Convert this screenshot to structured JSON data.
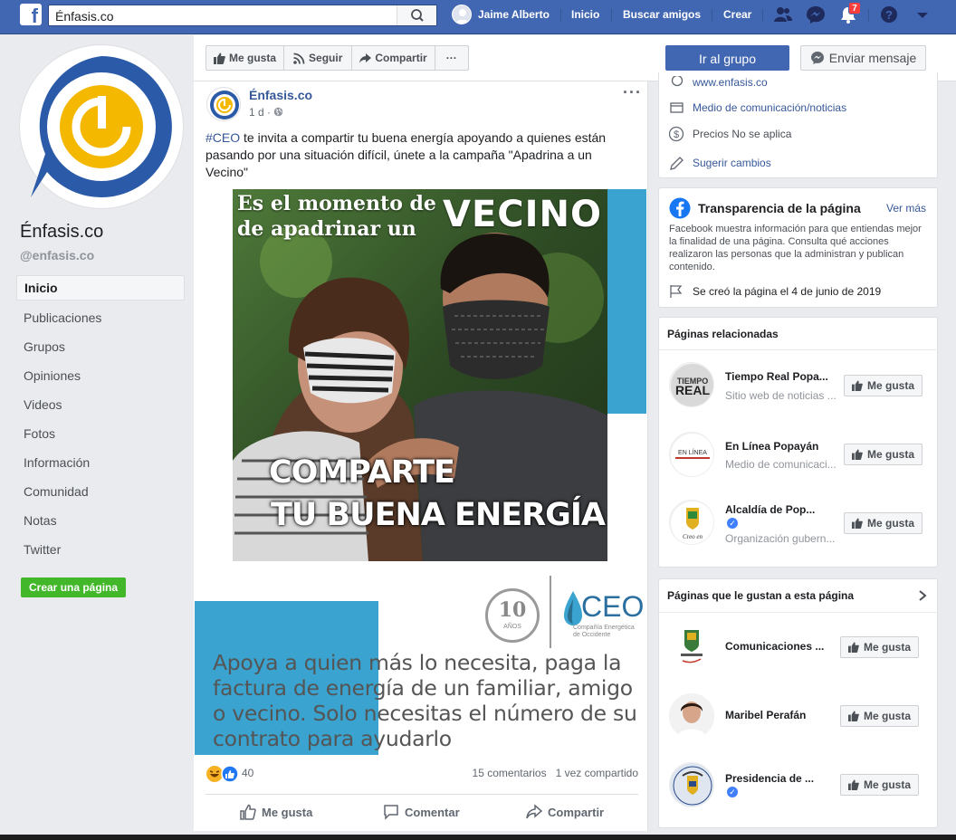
{
  "topbar": {
    "search_value": "Énfasis.co",
    "user_name": "Jaime Alberto",
    "nav": [
      "Inicio",
      "Buscar amigos",
      "Crear"
    ],
    "notifications_count": "7",
    "icons": [
      "friends-icon",
      "messenger-icon",
      "bell-icon",
      "help-icon",
      "caret-down-icon"
    ]
  },
  "page": {
    "name": "Énfasis.co",
    "handle": "@enfasis.co"
  },
  "sidebar": {
    "items": [
      {
        "label": "Inicio"
      },
      {
        "label": "Publicaciones"
      },
      {
        "label": "Grupos"
      },
      {
        "label": "Opiniones"
      },
      {
        "label": "Videos"
      },
      {
        "label": "Fotos"
      },
      {
        "label": "Información"
      },
      {
        "label": "Comunidad"
      },
      {
        "label": "Notas"
      },
      {
        "label": "Twitter"
      }
    ],
    "create_page": "Crear una página"
  },
  "actions": {
    "like": "Me gusta",
    "follow": "Seguir",
    "share": "Compartir",
    "more": "···",
    "go_group": "Ir al grupo",
    "send_message": "Enviar mensaje"
  },
  "post": {
    "author": "Énfasis.co",
    "time": "1 d ·",
    "hashtag": "#CEO",
    "text": " te invita a compartir tu buena energía apoyando a quienes están pasando por una situación difícil, únete a la campaña \"Apadrina a un Vecino\"",
    "image": {
      "heading_line1": "Es el momento de",
      "heading_line2": "de apadrinar un",
      "heading_big": "VECINO",
      "slogan_line1": "COMPARTE",
      "slogan_line2": "TU BUENA ENERGÍA",
      "seal_number": "10",
      "seal_text": "AÑOS",
      "ceo_logo": "CEO",
      "ceo_sub": "Compañía Energética de Occidente",
      "caption": "Apoya a quien más lo necesita, paga la factura de energía de un familiar, amigo o vecino. Solo necesitas el número de su contrato para ayudarlo"
    },
    "reactions_count": "40",
    "comments": "15 comentarios",
    "shares": "1 vez compartido",
    "like_action": "Me gusta",
    "comment_action": "Comentar",
    "share_action": "Compartir"
  },
  "about": {
    "website": "www.enfasis.co",
    "category": "Medio de comunicación/noticias",
    "price": "Precios No se aplica",
    "suggest": "Sugerir cambios"
  },
  "transparency": {
    "title": "Transparencia de la página",
    "see_more": "Ver más",
    "description": "Facebook muestra información para que entiendas mejor la finalidad de una página. Consulta qué acciones realizaron las personas que la administran y publican contenido.",
    "created": "Se creó la página el 4 de junio de 2019"
  },
  "related": {
    "title": "Páginas relacionadas",
    "items": [
      {
        "name": "Tiempo Real Popa...",
        "sub": "Sitio web de noticias ...",
        "like": "Me gusta"
      },
      {
        "name": "En Línea Popayán",
        "sub": "Medio de comunicaci...",
        "like": "Me gusta"
      },
      {
        "name": "Alcaldía de Pop...",
        "sub": "Organización gubern...",
        "like": "Me gusta"
      }
    ]
  },
  "liked_pages": {
    "title": "Páginas que le gustan a esta página",
    "items": [
      {
        "name": "Comunicaciones ...",
        "like": "Me gusta"
      },
      {
        "name": "Maribel Perafán",
        "like": "Me gusta"
      },
      {
        "name": "Presidencia de ...",
        "like": "Me gusta"
      }
    ]
  },
  "colors": {
    "facebook_blue": "#4267b2",
    "link": "#365899",
    "create_green": "#42b72a",
    "image_accent": "#3aa3cf",
    "badge_red": "#fa3e3e"
  }
}
